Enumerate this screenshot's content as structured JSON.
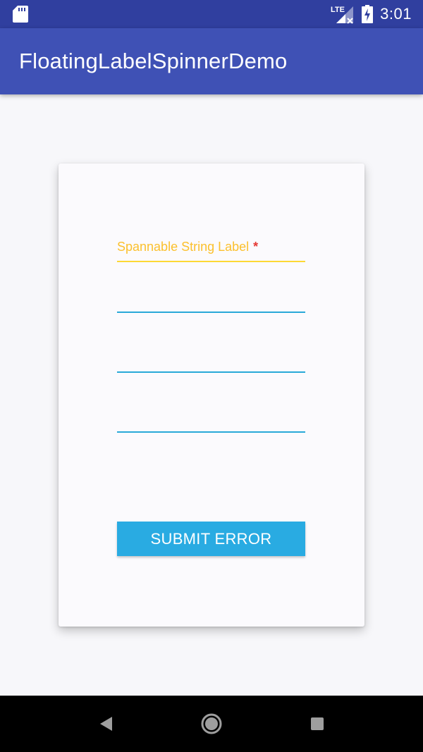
{
  "status_bar": {
    "time": "3:01",
    "network_label": "LTE"
  },
  "app_bar": {
    "title": "FloatingLabelSpinnerDemo"
  },
  "form": {
    "spinner1": {
      "label": "Spannable String Label",
      "required_mark": "*"
    },
    "submit_label": "SUBMIT ERROR"
  },
  "colors": {
    "primary_dark": "#303f9f",
    "primary": "#3f51b5",
    "accent_label": "#fbc02d",
    "required": "#e53935",
    "underline": "#29a9d8",
    "button": "#29abe2"
  },
  "icons": {
    "status_left": "sd-card-icon",
    "status_right": [
      "lte-signal-icon",
      "battery-charging-icon"
    ],
    "nav": [
      "back-icon",
      "home-icon",
      "recents-icon"
    ]
  }
}
